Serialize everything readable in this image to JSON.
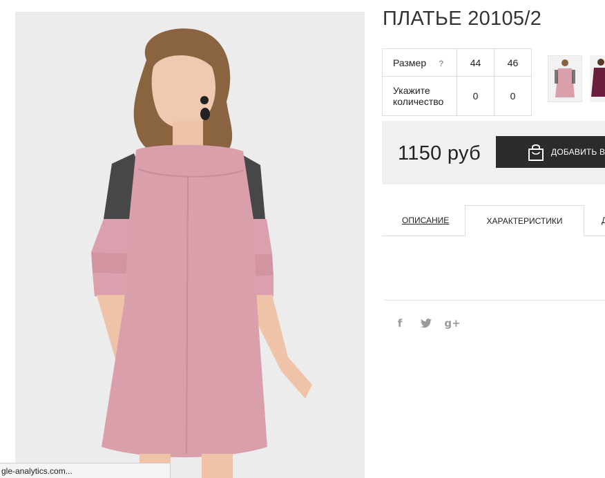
{
  "product": {
    "title": "ПЛАТЬЕ 20105/2",
    "price": "1150 руб"
  },
  "size_table": {
    "size_label": "Размер",
    "help_label": "?",
    "sizes": [
      "44",
      "46"
    ],
    "quantity_label_line1": "Укажите",
    "quantity_label_line2": "количество",
    "quantities": [
      "0",
      "0"
    ]
  },
  "cart": {
    "button_label": "ДОБАВИТЬ В"
  },
  "tabs": [
    {
      "label": "ОПИСАНИЕ"
    },
    {
      "label": "ХАРАКТЕРИСТИКИ"
    },
    {
      "label": "Д"
    }
  ],
  "social": {
    "facebook": "f",
    "twitter": "twitter-icon",
    "googleplus": "g+"
  },
  "statusbar": {
    "text": "gle-analytics.com..."
  },
  "colors": {
    "dress_pink": "#d9a0ab",
    "button_dark": "#2b2b2b",
    "price_bg": "#f0f0f0",
    "second_color_swatch": "#6b1d3d"
  }
}
